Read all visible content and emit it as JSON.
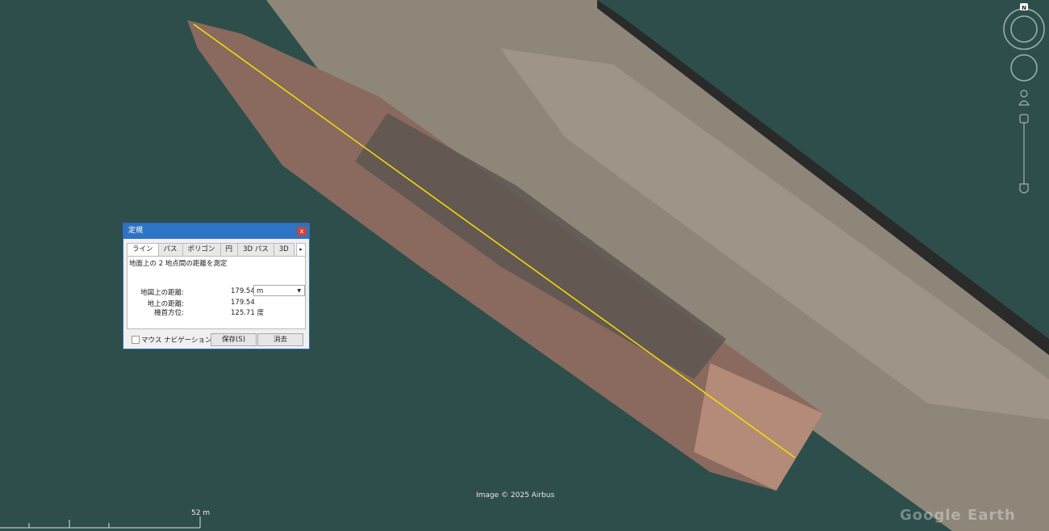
{
  "dialog": {
    "title": "定規",
    "close": "x",
    "tabs": [
      "ライン",
      "パス",
      "ポリゴン",
      "円",
      "3D パス",
      "3D"
    ],
    "tab_scroll": "▸",
    "description": "地面上の 2 地点間の距離を測定",
    "map_distance_label": "地図上の距離:",
    "map_distance_value": "179.54",
    "unit": "m",
    "ground_distance_label": "地上の距離:",
    "ground_distance_value": "179.54",
    "heading_label": "機首方位:",
    "heading_value": "125.71 度",
    "mouse_nav_label": "マウス ナビゲーション",
    "save_label": "保存(S)",
    "clear_label": "消去"
  },
  "map": {
    "credit": "Image © 2025 Airbus",
    "scale_label": "52 m",
    "compass_north": "N",
    "watermark": "Google Earth",
    "line_color": "#f5e000"
  }
}
